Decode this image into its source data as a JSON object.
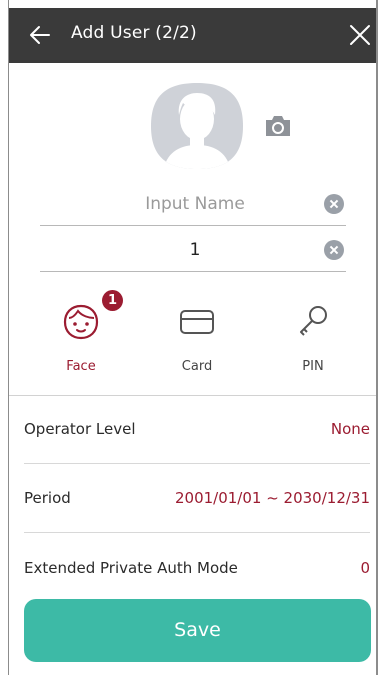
{
  "header": {
    "title": "Add User (2/2)",
    "back_icon": "arrow-left-icon",
    "close_icon": "close-icon",
    "background": "#3a3a3a"
  },
  "profile": {
    "avatar_icon": "user-avatar-icon",
    "camera_icon": "camera-icon"
  },
  "fields": {
    "name": {
      "value": "",
      "placeholder": "Input Name"
    },
    "number": {
      "value": "1",
      "placeholder": ""
    }
  },
  "auth_methods": [
    {
      "label": "Face",
      "icon": "face-icon",
      "badge": "1",
      "active": true
    },
    {
      "label": "Card",
      "icon": "card-icon",
      "badge": null,
      "active": false
    },
    {
      "label": "PIN",
      "icon": "key-icon",
      "badge": null,
      "active": false
    }
  ],
  "settings": [
    {
      "label": "Operator Level",
      "value": "None"
    },
    {
      "label": "Period",
      "value": "2001/01/01 ~ 2030/12/31"
    },
    {
      "label": "Extended Private Auth Mode",
      "value": "0"
    }
  ],
  "save_label": "Save",
  "colors": {
    "accent": "#9b1c31",
    "save_button": "#3dbaa6",
    "clear_button": "#9aa0a8"
  }
}
